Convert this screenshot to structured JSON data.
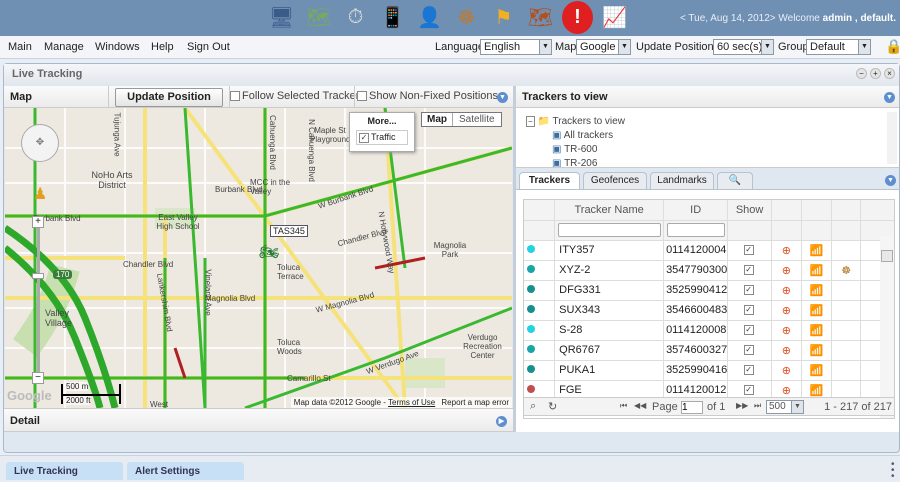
{
  "header": {
    "date": "< Tue, Aug 14, 2012>",
    "welcome": "Welcome",
    "user": "admin , default.",
    "icons": [
      "monitor-easel-icon",
      "map-pin-icon",
      "stopwatch-icon",
      "phone-icon",
      "user-icon",
      "steering-wheel-icon",
      "flag-icon",
      "route-map-icon",
      "alert-icon",
      "report-chart-icon"
    ]
  },
  "menu": {
    "items": [
      "Main",
      "Manage",
      "Windows",
      "Help",
      "Sign Out"
    ],
    "language_label": "Language",
    "language": "English",
    "map_label": "Map",
    "map": "Google",
    "update_label": "Update Positions",
    "update": "60 sec(s)",
    "group_label": "Group",
    "group": "Default"
  },
  "window": {
    "title": "Live Tracking"
  },
  "map_panel": {
    "title": "Map",
    "update_btn": "Update Position Now",
    "follow": "Follow Selected Tracker",
    "non_fixed": "Show Non-Fixed Positions",
    "more": "More...",
    "traffic": "Traffic",
    "map_btn": "Map",
    "satellite_btn": "Satellite",
    "attribution": "Map data ©2012 Google -",
    "terms": "Terms of Use",
    "report": "Report a map error",
    "scale_m": "500 m",
    "scale_ft": "2000 ft",
    "google": "Google",
    "marker": "TAS345",
    "highway": "170",
    "labels": [
      "Tujunga Ave",
      "Cahuenga Blvd",
      "N Cahuenga Blvd",
      "Maple St Playground",
      "NoHo Arts District",
      "MCC in the Valley",
      "East Valley High School",
      "Burbank Blvd",
      "W Burbank Blvd",
      "Chandler Blvd",
      "Chandler Blvd",
      "Magnolia Park",
      "Toluca Terrace",
      "Magnolia Blvd",
      "W Magnolia Blvd",
      "Lankershim Blvd",
      "Vineland Ave",
      "N Hollywood Way",
      "Valley Village",
      "Toluca Woods",
      "Verdugo Recreation Center",
      "W Verdugo Ave",
      "Camarillo St",
      "West"
    ]
  },
  "detail": {
    "title": "Detail"
  },
  "trackers_view": {
    "title": "Trackers to view",
    "root": "Trackers to view",
    "items": [
      "All trackers",
      "TR-600",
      "TR-206"
    ]
  },
  "tabs": [
    "Trackers",
    "Geofences",
    "Landmarks"
  ],
  "grid": {
    "headers": [
      "Tracker Name",
      "ID",
      "Show"
    ],
    "rows": [
      {
        "name": "ITY357",
        "id": "0114120004",
        "status": "#22d3e0",
        "wheel": false
      },
      {
        "name": "XYZ-2",
        "id": "3547790300",
        "status": "#1aa6a6",
        "wheel": true
      },
      {
        "name": "DFG331",
        "id": "3525990412",
        "status": "#14908f",
        "wheel": false
      },
      {
        "name": "SUX343",
        "id": "3546600483",
        "status": "#14908f",
        "wheel": false
      },
      {
        "name": "S-28",
        "id": "0114120008",
        "status": "#22d3e0",
        "wheel": false
      },
      {
        "name": "QR6767",
        "id": "3574600327",
        "status": "#1aa6a6",
        "wheel": false
      },
      {
        "name": "PUKA1",
        "id": "3525990416",
        "status": "#14908f",
        "wheel": false
      },
      {
        "name": "FGE",
        "id": "0114120012",
        "status": "#c05050",
        "wheel": false
      }
    ],
    "page_label": "Page",
    "page": "1",
    "of": "of 1",
    "page_size": "500",
    "range": "1 - 217 of 217"
  },
  "bottom_tabs": [
    "Live Tracking",
    "Alert Settings"
  ]
}
